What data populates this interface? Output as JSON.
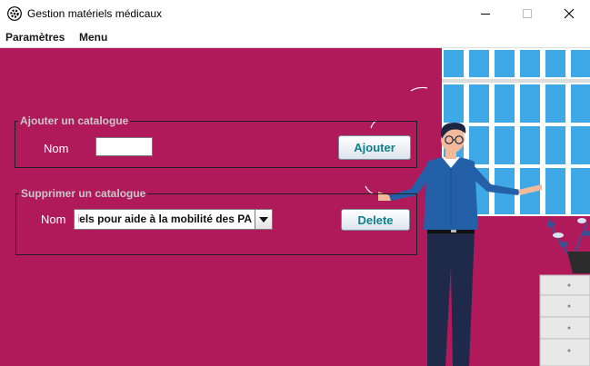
{
  "window": {
    "title": "Gestion matériels médicaux"
  },
  "menu": {
    "items": [
      {
        "label": "Paramètres"
      },
      {
        "label": "Menu"
      }
    ]
  },
  "add_catalog": {
    "legend": "Ajouter un catalogue",
    "name_label": "Nom",
    "name_value": "",
    "button_label": "Ajouter"
  },
  "delete_catalog": {
    "legend": "Supprimer un catalogue",
    "name_label": "Nom",
    "selected_value": "riels pour aide à la mobilité des PA",
    "button_label": "Delete"
  },
  "colors": {
    "background": "#b0195a",
    "window_blue": "#3fa9e8",
    "button_text": "#0f7f8a"
  },
  "icons": [
    "app-gear-icon",
    "minimize-icon",
    "maximize-icon",
    "close-icon",
    "dropdown-arrow-icon"
  ]
}
